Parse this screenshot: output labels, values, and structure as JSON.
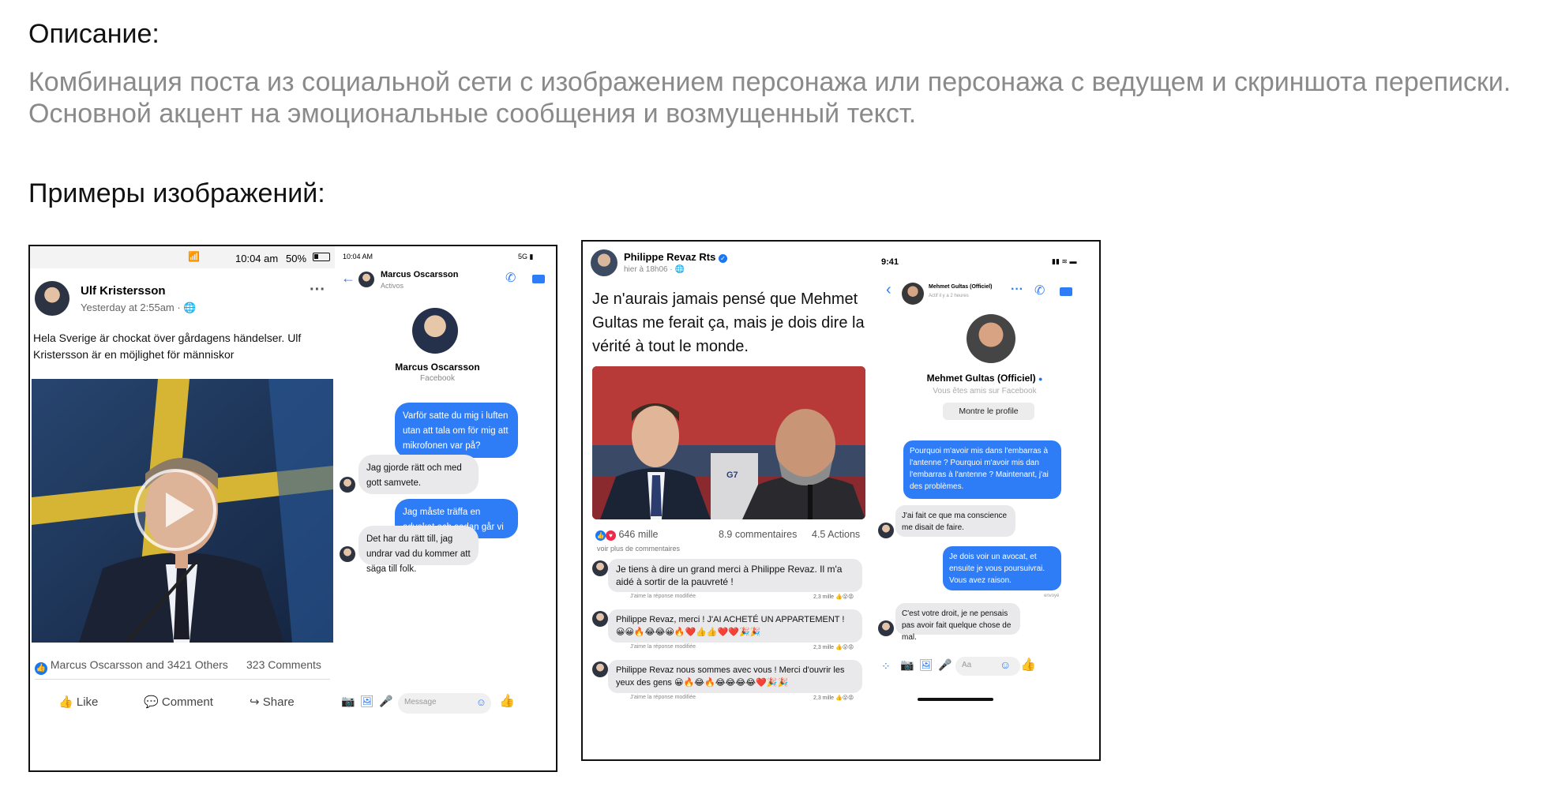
{
  "page": {
    "description_heading": "Описание:",
    "description_text": "Комбинация поста из социальной сети с изображением персонажа или персонажа с ведущем и скриншота переписки. Основной акцент на эмоциональные сообщения и возмущенный текст.",
    "examples_heading": "Примеры изображений:"
  },
  "example1": {
    "status_bar": {
      "time": "10:04 am",
      "battery": "50%"
    },
    "post": {
      "author": "Ulf Kristersson",
      "timestamp": "Yesterday at 2:55am · ",
      "text": "Hela Sverige är chockat över gårdagens händelser. Ulf Kristersson är en möjlighet för människor",
      "reactions": "Marcus Oscarsson and 3421 Others",
      "comments": "323 Comments",
      "actions": {
        "like": "Like",
        "comment": "Comment",
        "share": "Share"
      }
    },
    "messenger": {
      "status_time": "10:04 AM",
      "network": "5G",
      "contact_name": "Marcus Oscarsson",
      "contact_status": "Activos",
      "profile_name": "Marcus Oscarsson",
      "profile_sub": "Facebook",
      "messages": [
        {
          "from": "me",
          "text": "Varför satte du mig i luften utan att tala om för mig att mikrofonen var på?"
        },
        {
          "from": "them",
          "text": "Jag gjorde rätt och med gott samvete."
        },
        {
          "from": "me",
          "text": "Jag måste träffa en advokat och sedan går vi till domstol."
        },
        {
          "from": "them",
          "text": "Det har du rätt till, jag undrar vad du kommer att säga till folk."
        }
      ],
      "input_placeholder": "Message"
    }
  },
  "example2": {
    "post": {
      "author": "Philippe Revaz Rts",
      "timestamp": "hier à 18h06 · ",
      "text": "Je n'aurais jamais pensé que Mehmet Gultas me ferait ça, mais je dois dire la vérité à tout le monde.",
      "reactions_count": "646 mille",
      "comments_count": "8.9 commentaires",
      "actions_count": "4.5 Actions",
      "more_comments": "voir plus de commentaires",
      "tv_logo": "G7",
      "comments": [
        {
          "text": "Je tiens à dire un grand merci à Philippe Revaz. Il m'a aidé à sortir de la pauvreté !",
          "meta": "J'aime la réponse modifiée",
          "count": "2,3 mille"
        },
        {
          "text": "Philippe Revaz, merci ! J'AI ACHETÉ UN APPARTEMENT ! 😀😀🔥😂😂😀🔥❤️👍👍❤️❤️🎉🎉",
          "meta": "J'aime la réponse modifiée",
          "count": "2,3 mille"
        },
        {
          "text": "Philippe Revaz nous sommes avec vous ! Merci d'ouvrir les yeux des gens 😀🔥😂🔥😂😂😂😂❤️🎉🎉",
          "meta": "J'aime la réponse modifiée",
          "count": "2,3 mille"
        }
      ]
    },
    "messenger": {
      "status_time": "9:41",
      "contact_name": "Mehmet Gultas (Officiel)",
      "contact_status": "Actif il y a 2 heures",
      "profile_name": "Mehmet Gultas (Officiel)",
      "profile_sub": "Vous êtes amis sur Facebook",
      "profile_button": "Montre le profile",
      "messages": [
        {
          "from": "me",
          "text": "Pourquoi m'avoir mis dans l'embarras à l'antenne ? Pourquoi m'avoir mis dan l'embarras à l'antenne ? Maintenant, j'ai des problèmes."
        },
        {
          "from": "them",
          "text": "J'ai fait ce que ma conscience me disait de faire."
        },
        {
          "from": "me",
          "text": "Je dois voir un avocat, et ensuite je vous poursuivrai. Vous avez raison."
        },
        {
          "from": "them",
          "text": "C'est votre droit, je ne pensais pas avoir fait quelque chose de mal."
        }
      ],
      "seen_label": "envoyé",
      "input_placeholder": "Aa"
    }
  },
  "colors": {
    "messenger_blue": "#2f7df6",
    "bubble_gray": "#e9e9eb",
    "heading_text": "#111111",
    "description_text": "#8a8a8a"
  }
}
